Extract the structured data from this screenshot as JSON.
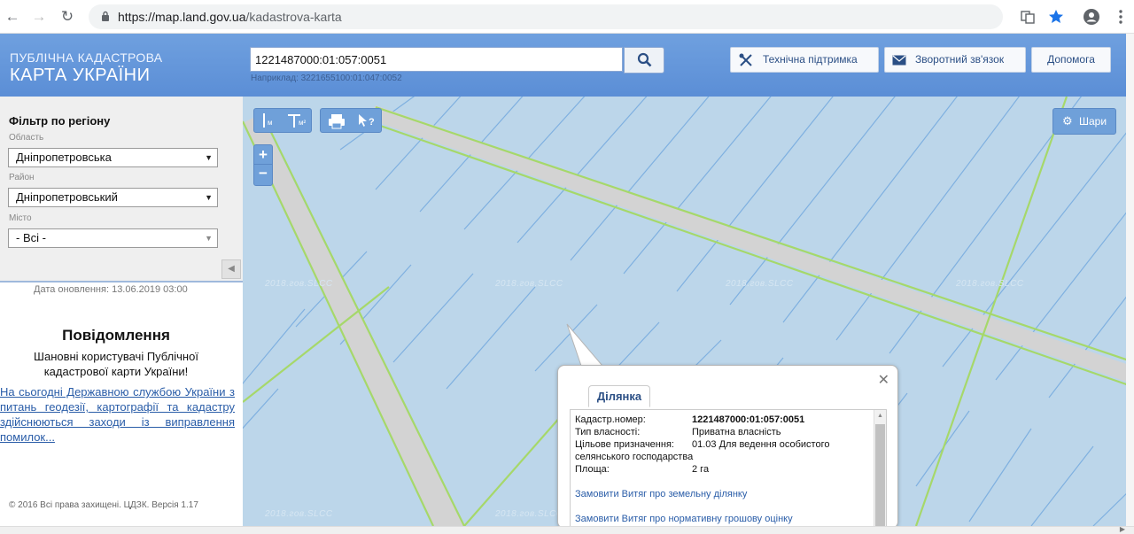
{
  "browser": {
    "url_host": "https://map.land.gov.ua",
    "url_path": "/kadastrova-karta"
  },
  "header": {
    "logo_line1": "ПУБЛІЧНА КАДАСТРОВА",
    "logo_line2": "КАРТА УКРАЇНИ",
    "search_value": "1221487000:01:057:0051",
    "search_hint": "Наприклад: 3221655100:01:047:0052",
    "support_label": "Технічна підтримка",
    "feedback_label": "Зворотний зв'язок",
    "help_label": "Допомога"
  },
  "filter": {
    "title": "Фільтр по регіону",
    "region_label": "Область",
    "region_value": "Дніпропетровська",
    "district_label": "Район",
    "district_value": "Дніпропетровський",
    "city_label": "Місто",
    "city_value": "- Всі -"
  },
  "sidebar": {
    "updated": "Дата оновлення: 13.06.2019 03:00",
    "notice_title": "Повідомлення",
    "notice_greeting": "Шановні користувачі Публічної кадастрової карти України!",
    "notice_link": "На сьогодні Державною службою України з питань геодезії, картографії та кадастру здійснюються заходи із виправлення помилок...",
    "copyright": "© 2016 Всі права захищені. ЦДЗК. Версія 1.17"
  },
  "map": {
    "layers_label": "Шари",
    "watermark": "2018.гов.SLCC",
    "tool_labels": {
      "measure_m": "м",
      "measure_area": "м²",
      "identify": "?"
    }
  },
  "popup": {
    "tab": "Ділянка",
    "rows": [
      {
        "label": "Кадастр.номер:",
        "value": "1221487000:01:057:0051"
      },
      {
        "label": "Тип власності:",
        "value": "Приватна власність"
      },
      {
        "label": "Цільове призначення:",
        "value": "01.03 Для ведення особистого"
      },
      {
        "label": "",
        "value": "селянського господарства"
      },
      {
        "label": "Площа:",
        "value": "2 га"
      }
    ],
    "link1": "Замовити Витяг про земельну ділянку",
    "link2": "Замовити Витяг про нормативну грошову оцінку"
  },
  "colors": {
    "header": "#5b8ed6",
    "map_bg": "#bcd6ea",
    "parcel_line": "#7fb0e0",
    "road": "#d0d0d0",
    "boundary": "#a6d86a"
  }
}
